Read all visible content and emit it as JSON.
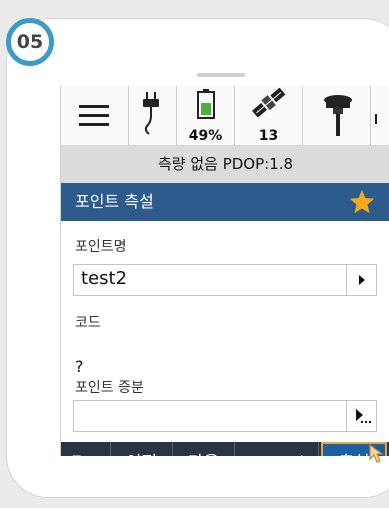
{
  "badge": {
    "number": "05"
  },
  "status_bar": {
    "battery": "49%",
    "satellites": "13"
  },
  "info_bar": {
    "text": "측량 없음 PDOP:1.8"
  },
  "title_bar": {
    "title": "포인트 측설"
  },
  "form": {
    "point_name_label": "포인트명",
    "point_name_value": "test2",
    "code_label": "코드",
    "code_value": "?",
    "increment_label": "포인트 증분",
    "increment_value": ""
  },
  "bottom_bar": {
    "esc": "Esc",
    "prev": "이전",
    "next": "다음",
    "more": "►",
    "measure": "측설"
  },
  "colors": {
    "title_bar": "#2c5b8c",
    "bottom_bar": "#2a3443",
    "highlight": "#e7a73a",
    "badge_ring": "#3d9cc4",
    "star": "#f4a81d"
  },
  "icons": [
    "menu-icon",
    "power-plug-icon",
    "battery-icon",
    "satellite-icon",
    "gnss-receiver-icon",
    "star-icon",
    "arrow-right-icon",
    "arrow-right-dots-icon",
    "pointer-cursor-icon"
  ]
}
